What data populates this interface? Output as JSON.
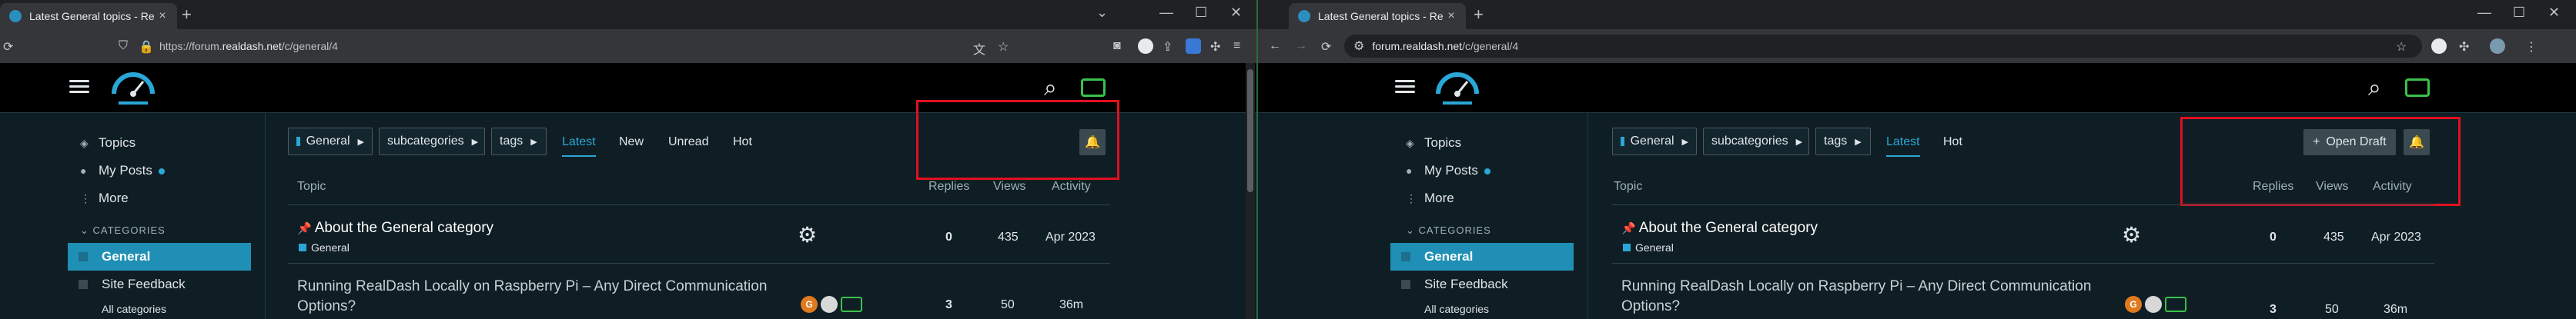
{
  "tab": {
    "title": "Latest General topics - RealDash",
    "close": "×",
    "new": "+"
  },
  "window_controls": {
    "min": "—",
    "max": "☐",
    "close": "✕",
    "chevron": "⌄"
  },
  "url_left": {
    "prefix": "https://forum.",
    "host": "realdash.net",
    "path": "/c/general/4"
  },
  "url_right": {
    "prefix": "",
    "host": "forum.realdash.net",
    "path": "/c/general/4"
  },
  "sidebar": {
    "topics": "Topics",
    "my_posts": "My Posts",
    "more": "More",
    "categories_header": "CATEGORIES",
    "categories": [
      "General",
      "Site Feedback",
      "All categories"
    ]
  },
  "nav": {
    "category": "General",
    "subcategories": "subcategories",
    "tags": "tags",
    "latest": "Latest",
    "new": "New",
    "unread": "Unread",
    "hot": "Hot"
  },
  "buttons": {
    "open_draft": "Open Draft",
    "plus": "+",
    "bell": "🔔"
  },
  "table": {
    "headers": {
      "topic": "Topic",
      "replies": "Replies",
      "views": "Views",
      "activity": "Activity"
    },
    "rows": [
      {
        "title": "About the General category",
        "category": "General",
        "replies": "0",
        "views": "435",
        "activity": "Apr 2023"
      },
      {
        "title_line1": "Running RealDash Locally on Raspberry Pi – Any Direct Communication",
        "title_line2": "Options?",
        "replies": "3",
        "views": "50",
        "activity": "36m",
        "avatar_letter": "G"
      }
    ]
  },
  "icons": {
    "pin": "📌",
    "gear": "⚙",
    "search": "⌕",
    "back": "←",
    "forward": "→",
    "reload": "⟳"
  }
}
